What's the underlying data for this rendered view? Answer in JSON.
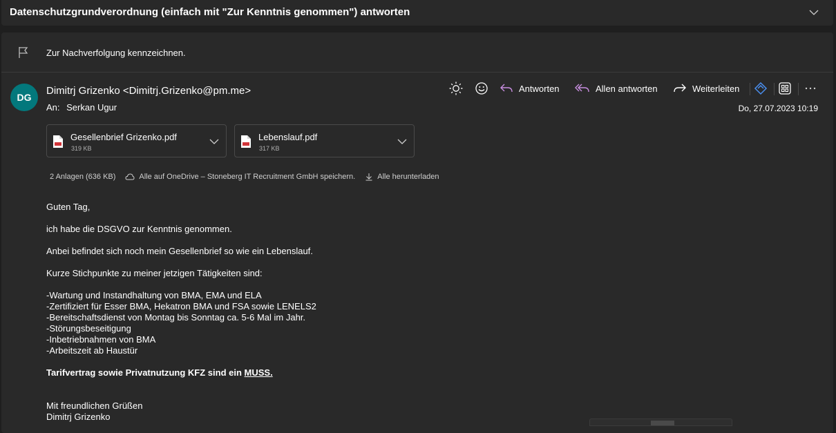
{
  "subject": "Datenschutzgrundverordnung (einfach mit \"Zur Kenntnis genommen\") antworten",
  "flag_text": "Zur Nachverfolgung kennzeichnen.",
  "sender": {
    "initials": "DG",
    "display": "Dimitrj Grizenko <Dimitrj.Grizenko@pm.me>",
    "avatar_color": "#03787c"
  },
  "to": {
    "label": "An:",
    "name": "Serkan Ugur"
  },
  "date": "Do, 27.07.2023 10:19",
  "toolbar": {
    "reply": "Antworten",
    "reply_all": "Allen antworten",
    "forward": "Weiterleiten",
    "accent_color": "#c88ee0"
  },
  "attachments": [
    {
      "name": "Gesellenbrief Grizenko.pdf",
      "size": "319 KB"
    },
    {
      "name": "Lebenslauf.pdf",
      "size": "317 KB"
    }
  ],
  "attachment_info": {
    "count": "2 Anlagen (636 KB)",
    "save_all": "Alle auf OneDrive – Stoneberg IT Recruitment GmbH speichern.",
    "download_all": "Alle herunterladen"
  },
  "body": {
    "greeting": "Guten Tag,",
    "line1": "ich habe die DSGVO zur Kenntnis genommen.",
    "line2": "Anbei befindet sich noch mein Gesellenbrief so wie ein Lebenslauf.",
    "line3": "Kurze Stichpunkte zu meiner jetzigen Tätigkeiten sind:",
    "items": [
      "-Wartung und Instandhaltung von BMA, EMA und ELA",
      "-Zertifiziert für Esser BMA, Hekatron BMA und FSA sowie LENELS2",
      "-Bereitschaftsdienst von Montag bis Sonntag ca. 5-6 Mal im Jahr.",
      "-Störungsbeseitigung",
      "-Inbetriebnahmen von BMA",
      "-Arbeitszeit ab Haustür"
    ],
    "bold_line_prefix": "Tarifvertrag sowie Privatnutzung KFZ sind ein ",
    "bold_line_underlined": "MUSS.",
    "closing": "Mit freundlichen Grüßen",
    "signature": "Dimitrj Grizenko"
  }
}
